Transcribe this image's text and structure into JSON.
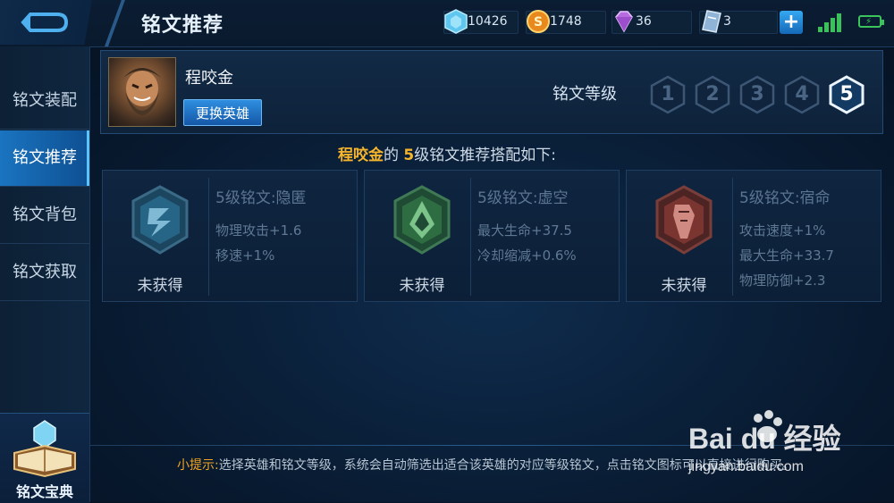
{
  "header": {
    "title": "铭文推荐",
    "resources": [
      {
        "name": "diamond",
        "icon": "diamond-icon",
        "value": "10426"
      },
      {
        "name": "gold",
        "icon": "gold-coin-icon",
        "value": "1748"
      },
      {
        "name": "gem",
        "icon": "purple-gem-icon",
        "value": "36"
      },
      {
        "name": "ticket",
        "icon": "voucher-icon",
        "value": "3"
      }
    ],
    "plus_label": "+"
  },
  "sidebar": {
    "items": [
      {
        "label": "铭文装配"
      },
      {
        "label": "铭文推荐",
        "active": true
      },
      {
        "label": "铭文背包"
      },
      {
        "label": "铭文获取"
      }
    ],
    "codex_label": "铭文宝典"
  },
  "hero": {
    "name": "程咬金",
    "change_button": "更换英雄",
    "level_label": "铭文等级",
    "levels": [
      "1",
      "2",
      "3",
      "4",
      "5"
    ],
    "selected_level": "5"
  },
  "headline": {
    "hero": "程咬金",
    "part1": "的",
    "level": "5",
    "part2": "级铭文推荐搭配如下:"
  },
  "runes": [
    {
      "title": "5级铭文:隐匿",
      "status": "未获得",
      "color": "#2f7fa6",
      "stats": [
        "物理攻击+1.6",
        "移速+1%"
      ]
    },
    {
      "title": "5级铭文:虚空",
      "status": "未获得",
      "color": "#3b8a4e",
      "stats": [
        "最大生命+37.5",
        "冷却缩减+0.6%"
      ]
    },
    {
      "title": "5级铭文:宿命",
      "status": "未获得",
      "color": "#a3443a",
      "stats": [
        "攻击速度+1%",
        "最大生命+33.7",
        "物理防御+2.3"
      ]
    }
  ],
  "tip": {
    "label": "小提示:",
    "text": "选择英雄和铭文等级，系统会自动筛选出适合该英雄的对应等级铭文，点击铭文图标可以直接进行购买。"
  },
  "watermark": {
    "brand": "Bai du 经验",
    "url": "jingyan.baidu.com"
  },
  "colors": {
    "accent": "#1a74c0",
    "highlight": "#f7b52c",
    "signal": "#39c25a"
  }
}
